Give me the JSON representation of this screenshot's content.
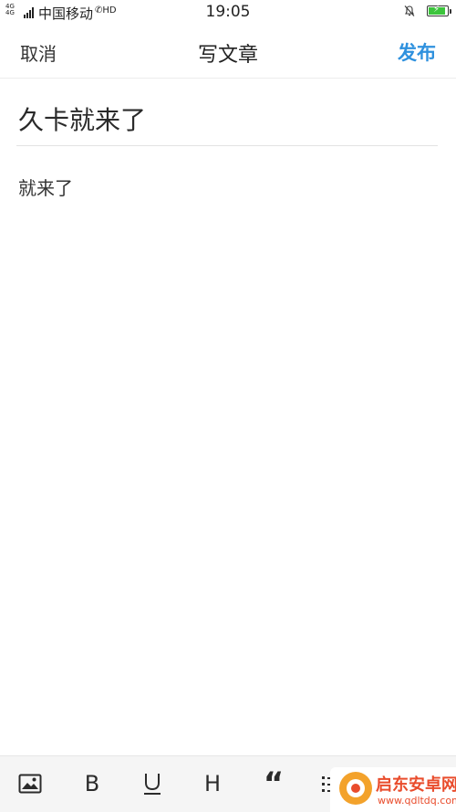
{
  "status_bar": {
    "network_type": "4G 4G",
    "carrier": "中国移动",
    "hd_label": "HD",
    "time": "19:05",
    "battery_color": "#3cc43c"
  },
  "header": {
    "cancel_label": "取消",
    "title": "写文章",
    "publish_label": "发布",
    "accent_color": "#2f91de"
  },
  "editor": {
    "title_value": "久卡就来了",
    "body_value": "就来了"
  },
  "toolbar": {
    "items": [
      {
        "name": "image",
        "icon": "image-icon",
        "glyph": ""
      },
      {
        "name": "bold",
        "icon": "bold-icon",
        "glyph": "B"
      },
      {
        "name": "underline",
        "icon": "underline-icon",
        "glyph": "U"
      },
      {
        "name": "heading",
        "icon": "heading-icon",
        "glyph": "H"
      },
      {
        "name": "quote",
        "icon": "quote-icon",
        "glyph": "“"
      },
      {
        "name": "list",
        "icon": "list-icon",
        "glyph": ""
      }
    ]
  },
  "watermark": {
    "name": "启东安卓网",
    "url": "www.qdltdq.com"
  }
}
